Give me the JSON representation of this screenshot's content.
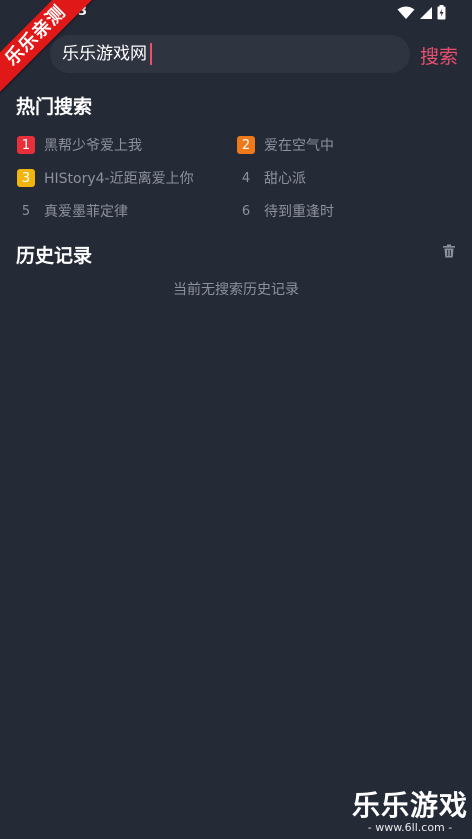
{
  "status_bar": {
    "time": "3",
    "icons": [
      "wifi-icon",
      "signal-icon",
      "battery-icon"
    ]
  },
  "ribbon": {
    "text": "乐乐亲测"
  },
  "search": {
    "value": "乐乐游戏网",
    "placeholder": "",
    "button_label": "搜索"
  },
  "hot": {
    "title": "热门搜索",
    "items": [
      {
        "rank": "1",
        "text": "黑帮少爷爱上我",
        "badge_color": "#e8303a"
      },
      {
        "rank": "2",
        "text": "爱在空气中",
        "badge_color": "#f07a1a"
      },
      {
        "rank": "3",
        "text": "HIStory4-近距离爱上你",
        "badge_color": "#f2b40f"
      },
      {
        "rank": "4",
        "text": "甜心派",
        "badge_color": ""
      },
      {
        "rank": "5",
        "text": "真爱墨菲定律",
        "badge_color": ""
      },
      {
        "rank": "6",
        "text": "待到重逢时",
        "badge_color": ""
      }
    ]
  },
  "history": {
    "title": "历史记录",
    "empty_text": "当前无搜索历史记录",
    "clear_icon": "trash-icon"
  },
  "watermark": {
    "title": "乐乐游戏",
    "url": "- www.6ll.com -"
  },
  "colors": {
    "background": "#252a37",
    "accent": "#e8506e",
    "muted_text": "#8d919c",
    "search_box": "#2f3441"
  }
}
